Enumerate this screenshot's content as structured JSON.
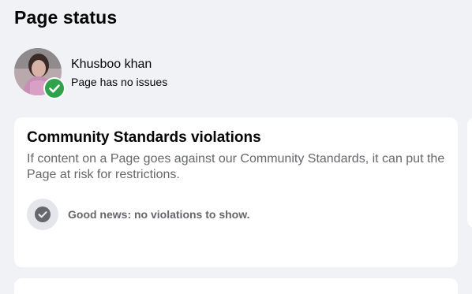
{
  "page_title": "Page status",
  "profile": {
    "name": "Khusboo khan",
    "status": "Page has no issues",
    "avatar_icon": "profile-photo",
    "badge_icon": "check-circle-icon",
    "badge_color": "#31a24c"
  },
  "violations_card": {
    "title": "Community Standards violations",
    "description": "If content on a Page goes against our Community Standards, it can put the Page at risk for restrictions.",
    "good_news_icon": "checkmark-circle-icon",
    "good_news_text": "Good news: no violations to show."
  },
  "colors": {
    "background": "#f0f2f5",
    "card": "#ffffff",
    "secondary_text": "#65676b",
    "icon_circle": "#e4e6eb"
  }
}
